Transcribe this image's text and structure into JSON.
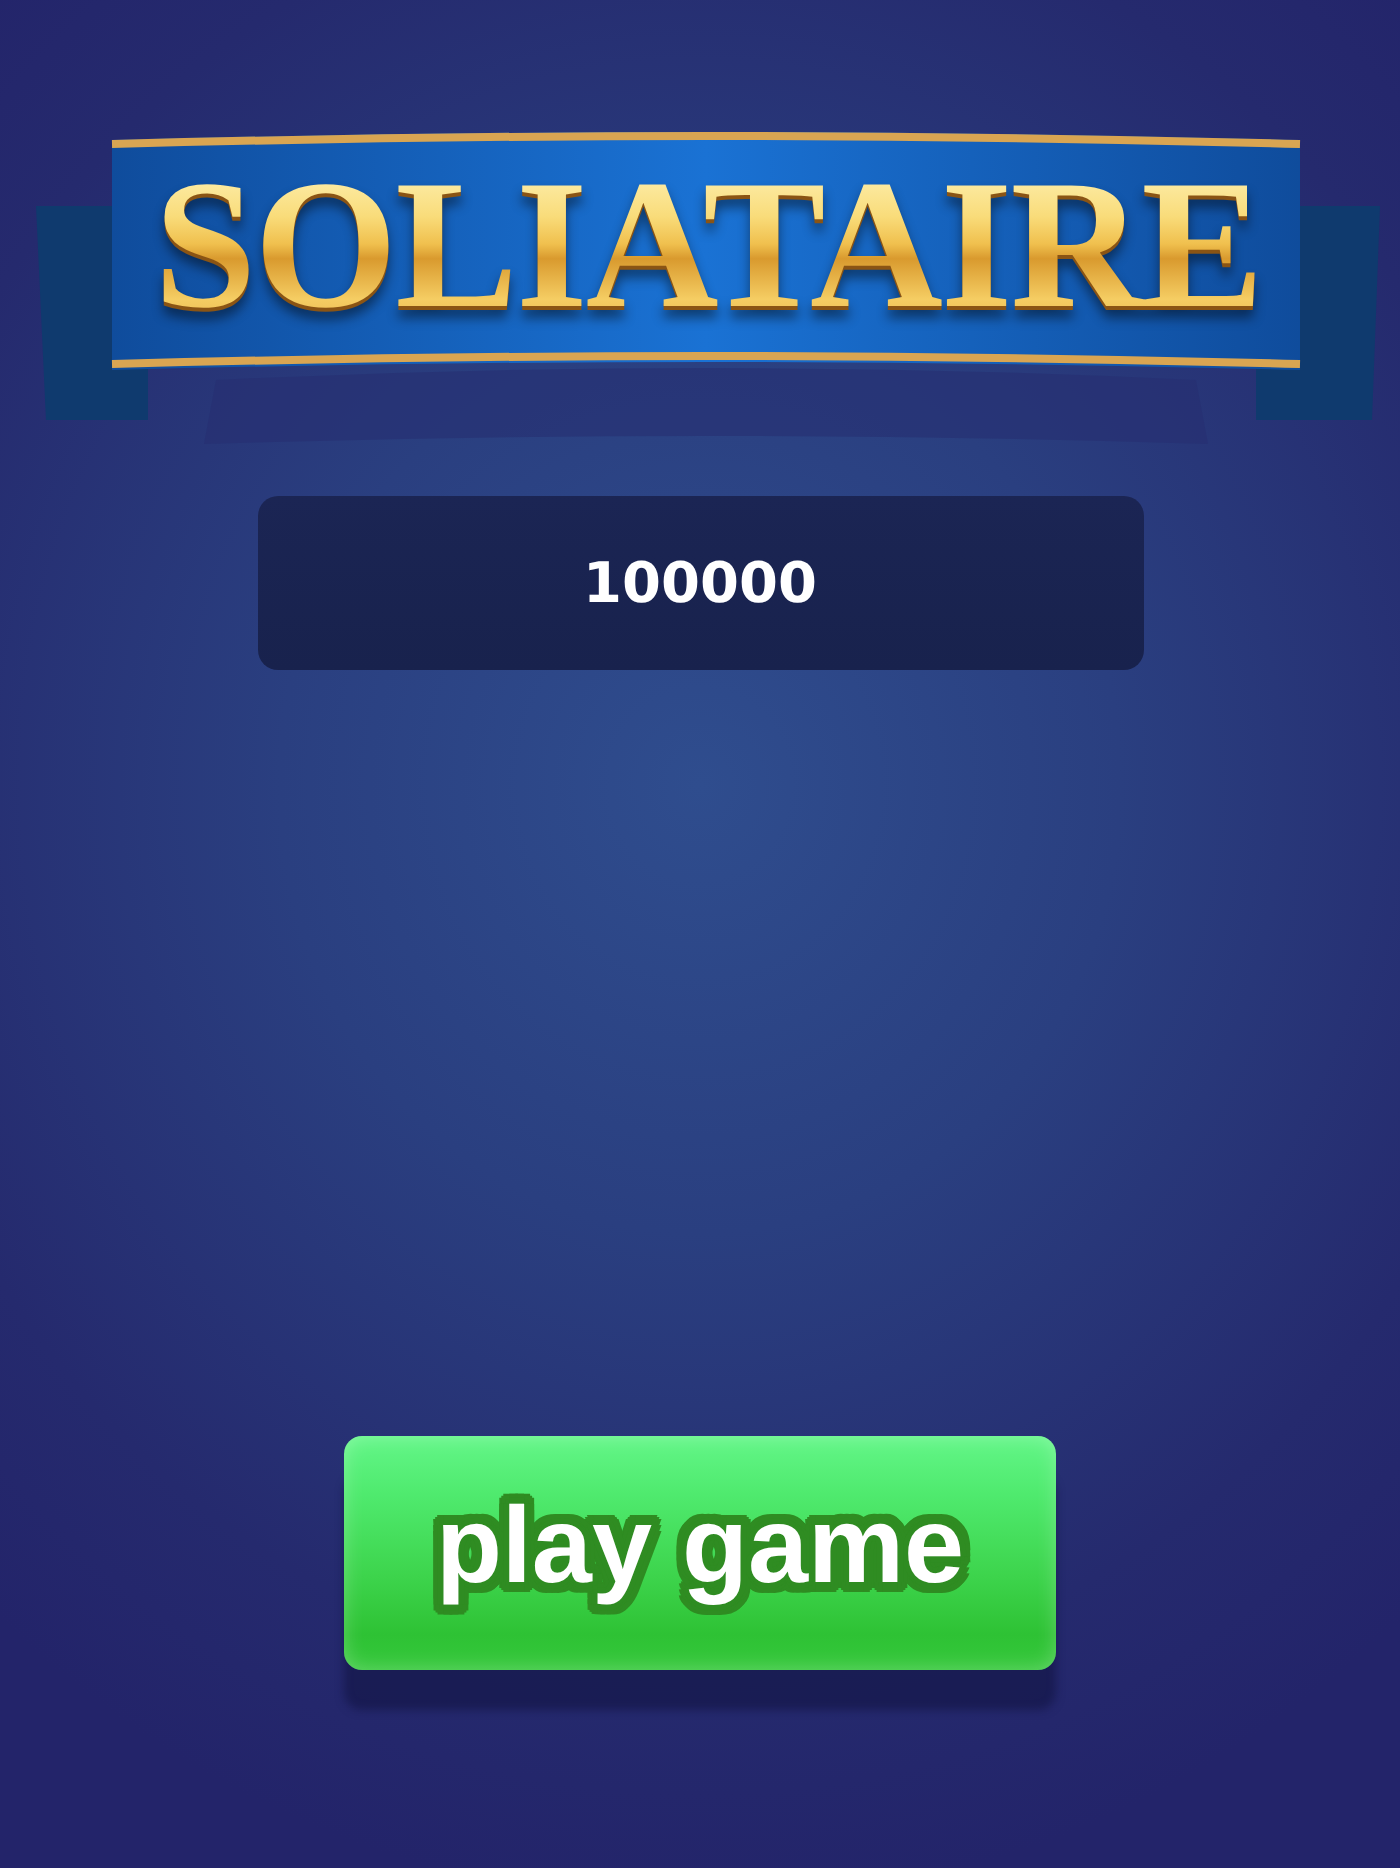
{
  "banner": {
    "title": "SOLIATAIRE"
  },
  "score_display": {
    "value": "100000"
  },
  "play_button": {
    "label": "play game"
  }
}
